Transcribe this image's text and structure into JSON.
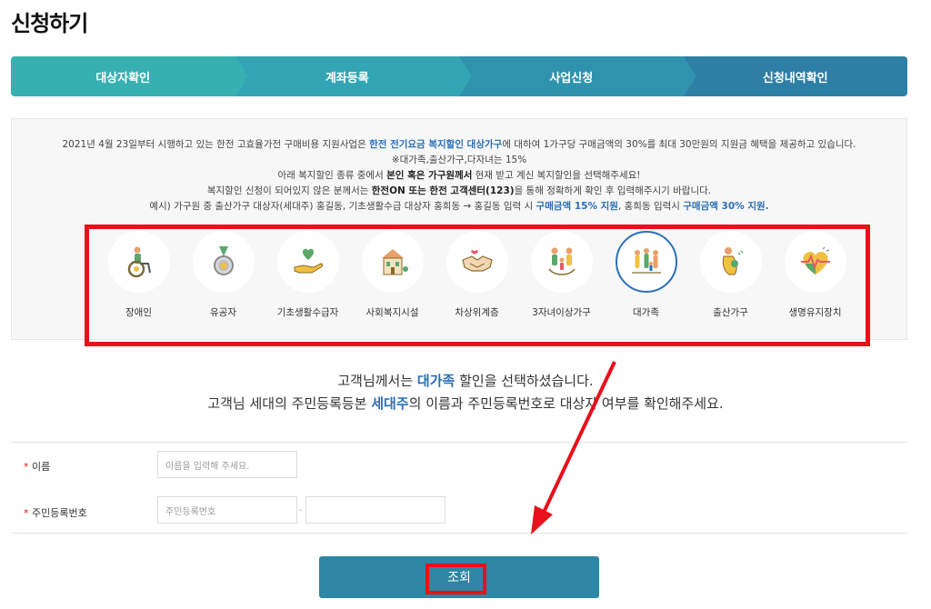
{
  "page": {
    "title": "신청하기"
  },
  "steps": [
    {
      "label": "대상자확인"
    },
    {
      "label": "계좌등록"
    },
    {
      "label": "사업신청"
    },
    {
      "label": "신청내역확인"
    }
  ],
  "info": {
    "line1_a": "2021년 4월 23일부터 시행하고 있는 한전 고효율가전 구매비용 지원사업은 ",
    "line1_hl": "한전 전기요금 복지할인 대상가구",
    "line1_b": "에 대하여 1가구당 구매금액의 30%를 최대 30만원의 지원금 혜택을 제공하고 있습니다.",
    "line2": "※대가족,출산가구,다자녀는 15%",
    "line3_a": "아래 복지할인 종류 중에서 ",
    "line3_b": "본인 혹은 가구원께서",
    "line3_c": " 현재 받고 계신 복지할인을 선택해주세요!",
    "line4_a": "복지할인 신청이 되어있지 않은 분께서는 ",
    "line4_b": "한전ON 또는 한전 고객센터(123)",
    "line4_c": "을 통해 정확하게 확인 후 입력해주시기 바랍니다.",
    "line5_a": "예시) 가구원 중 출산가구 대상자(세대주) 홍길동, 기초생활수급 대상자 홍희동 → 홍길동 입력 시 ",
    "line5_hl1": "구매금액 15% 지원",
    "line5_b": ", 홍희동 입력시 ",
    "line5_hl2": "구매금액 30% 지원."
  },
  "categories": [
    {
      "label": "장애인",
      "icon": "wheelchair-icon"
    },
    {
      "label": "유공자",
      "icon": "medal-icon"
    },
    {
      "label": "기초생활수급자",
      "icon": "hand-heart-icon"
    },
    {
      "label": "사회복지시설",
      "icon": "building-icon"
    },
    {
      "label": "차상위계층",
      "icon": "handshake-icon"
    },
    {
      "label": "3자녀이상가구",
      "icon": "family-icon"
    },
    {
      "label": "대가족",
      "icon": "big-family-icon",
      "selected": true
    },
    {
      "label": "출산가구",
      "icon": "mother-baby-icon"
    },
    {
      "label": "생명유지장치",
      "icon": "heartbeat-icon"
    }
  ],
  "message": {
    "line1_a": "고객님께서는 ",
    "line1_hl": "대가족",
    "line1_b": " 할인을 선택하셨습니다.",
    "line2_a": "고객님 세대의 주민등록등본 ",
    "line2_hl": "세대주",
    "line2_b": "의 이름과 주민등록번호로 대상자 여부를 확인해주세요."
  },
  "form": {
    "name_label": "이름",
    "name_placeholder": "이름을 입력해 주세요.",
    "id_label": "주민등록번호",
    "id_placeholder": "주민등록번호",
    "required_mark": "*",
    "separator": "-"
  },
  "submit": {
    "label": "조회"
  },
  "colors": {
    "accent": "#2a6fb8",
    "annotation": "#e8101a",
    "button": "#2d86a4"
  }
}
